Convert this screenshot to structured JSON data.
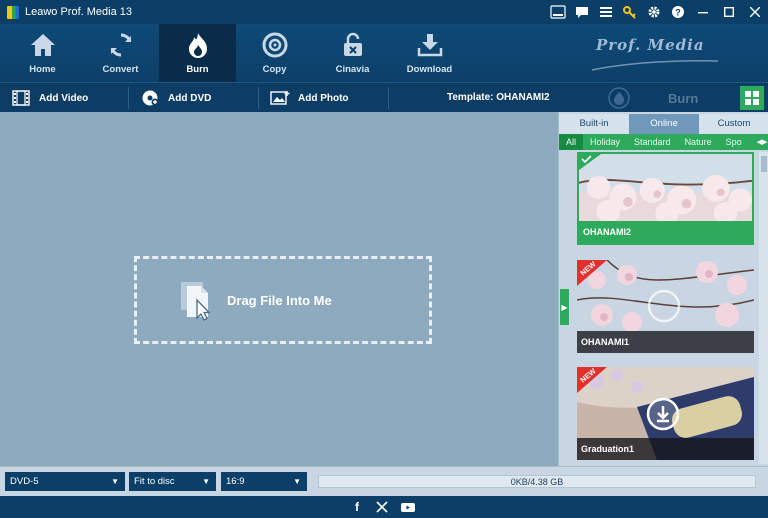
{
  "window": {
    "title": "Leawo Prof. Media 13",
    "controls": [
      "amd-icon",
      "chat-icon",
      "menu-icon",
      "key-icon",
      "gear-icon",
      "help-icon",
      "minimize-icon",
      "maximize-icon",
      "close-icon"
    ]
  },
  "nav": {
    "items": [
      {
        "label": "Home",
        "icon": "home-icon"
      },
      {
        "label": "Convert",
        "icon": "convert-icon"
      },
      {
        "label": "Burn",
        "icon": "burn-icon",
        "active": true
      },
      {
        "label": "Copy",
        "icon": "copy-icon"
      },
      {
        "label": "Cinavia",
        "icon": "cinavia-icon"
      },
      {
        "label": "Download",
        "icon": "download-icon"
      }
    ],
    "brand": "Prof. Media"
  },
  "toolbar": {
    "add_video": "Add Video",
    "add_dvd": "Add DVD",
    "add_photo": "Add Photo",
    "template": "Template: OHANAMI2",
    "burn": "Burn"
  },
  "main": {
    "drop_label": "Drag File Into Me"
  },
  "panel": {
    "tabs": [
      {
        "label": "Built-in"
      },
      {
        "label": "Online",
        "active": true
      },
      {
        "label": "Custom"
      }
    ],
    "categories": [
      {
        "label": "All",
        "active": true
      },
      {
        "label": "Holiday"
      },
      {
        "label": "Standard"
      },
      {
        "label": "Nature"
      },
      {
        "label": "Spo"
      }
    ],
    "templates": [
      {
        "name": "OHANAMI2",
        "selected": true,
        "new": false
      },
      {
        "name": "OHANAMI1",
        "selected": false,
        "new": true
      },
      {
        "name": "Graduation1",
        "selected": false,
        "new": true
      }
    ],
    "new_badge": "NEW"
  },
  "status": {
    "disc_type": "DVD-5",
    "fit_mode": "Fit to disc",
    "aspect": "16:9",
    "capacity": "0KB/4.38 GB"
  },
  "footer": {
    "social": [
      "facebook-icon",
      "x-twitter-icon",
      "youtube-icon"
    ]
  },
  "colors": {
    "accent_green": "#2eaa5c",
    "nav_dark": "#0c3f68",
    "drop_bg": "#8eaabf"
  }
}
